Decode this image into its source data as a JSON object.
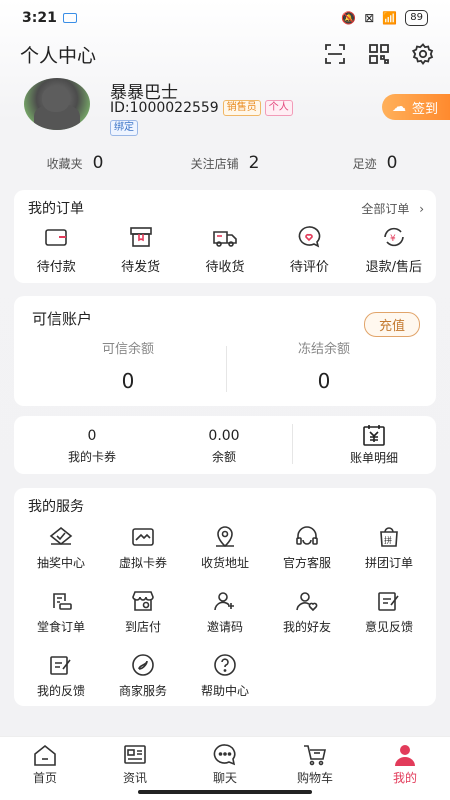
{
  "status": {
    "time": "3:21",
    "battery": "89"
  },
  "header": {
    "title": "个人中心"
  },
  "profile": {
    "name": "暴暴巴士",
    "id": "ID:1000022559",
    "tag_seller": "销售员",
    "tag_personal": "个人",
    "bind": "绑定",
    "signin": "签到"
  },
  "stats": [
    {
      "label": "收藏夹",
      "value": "0"
    },
    {
      "label": "关注店铺",
      "value": "2"
    },
    {
      "label": "足迹",
      "value": "0"
    }
  ],
  "orders": {
    "title": "我的订单",
    "all": "全部订单",
    "items": [
      {
        "label": "待付款",
        "icon": "wallet-icon"
      },
      {
        "label": "待发货",
        "icon": "box-icon"
      },
      {
        "label": "待收货",
        "icon": "truck-icon"
      },
      {
        "label": "待评价",
        "icon": "comment-icon"
      },
      {
        "label": "退款/售后",
        "icon": "refund-icon"
      }
    ]
  },
  "account": {
    "title": "可信账户",
    "recharge": "充值",
    "balance_label": "可信余额",
    "balance_value": "0",
    "frozen_label": "冻结余额",
    "frozen_value": "0"
  },
  "wallet": {
    "cards_value": "0",
    "cards_label": "我的卡券",
    "balance_value": "0.00",
    "balance_label": "余额",
    "bill_label": "账单明细"
  },
  "services": {
    "title": "我的服务",
    "items": [
      {
        "label": "抽奖中心",
        "icon": "lottery-icon"
      },
      {
        "label": "虚拟卡券",
        "icon": "voucher-icon"
      },
      {
        "label": "收货地址",
        "icon": "location-icon"
      },
      {
        "label": "官方客服",
        "icon": "headset-icon"
      },
      {
        "label": "拼团订单",
        "icon": "group-order-icon"
      },
      {
        "label": "堂食订单",
        "icon": "dine-in-icon"
      },
      {
        "label": "到店付",
        "icon": "store-icon"
      },
      {
        "label": "邀请码",
        "icon": "invite-icon"
      },
      {
        "label": "我的好友",
        "icon": "friends-icon"
      },
      {
        "label": "意见反馈",
        "icon": "feedback-icon"
      },
      {
        "label": "我的反馈",
        "icon": "my-feedback-icon"
      },
      {
        "label": "商家服务",
        "icon": "merchant-icon"
      },
      {
        "label": "帮助中心",
        "icon": "help-icon"
      }
    ]
  },
  "tabs": [
    {
      "label": "首页",
      "icon": "home-icon"
    },
    {
      "label": "资讯",
      "icon": "news-icon"
    },
    {
      "label": "聊天",
      "icon": "chat-icon"
    },
    {
      "label": "购物车",
      "icon": "cart-icon"
    },
    {
      "label": "我的",
      "icon": "user-icon",
      "active": true
    }
  ],
  "colors": {
    "accent": "#e23b5a",
    "signin": "#ff8a2e"
  }
}
